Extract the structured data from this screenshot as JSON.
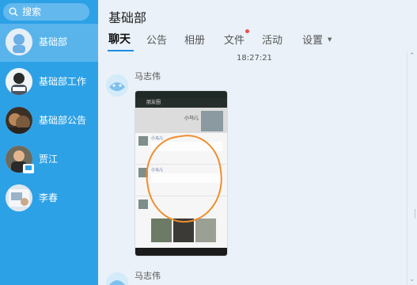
{
  "search": {
    "placeholder": "搜索"
  },
  "sidebar": {
    "items": [
      {
        "label": "基础部",
        "active": true
      },
      {
        "label": "基础部工作"
      },
      {
        "label": "基础部公告"
      },
      {
        "label": "贾江"
      },
      {
        "label": "李春"
      }
    ]
  },
  "header": {
    "title": "基础部",
    "tabs": [
      {
        "label": "聊天",
        "active": true
      },
      {
        "label": "公告"
      },
      {
        "label": "相册"
      },
      {
        "label": "文件",
        "has_dot": true
      },
      {
        "label": "活动"
      },
      {
        "label": "设置"
      }
    ]
  },
  "chat": {
    "timestamp": "18:27:21",
    "messages": [
      {
        "sender": "马志伟",
        "image": {
          "bar_title": "朋友圈",
          "cover_name": "小马儿",
          "post_name": "小马儿"
        }
      },
      {
        "sender": "马志伟"
      }
    ]
  },
  "colors": {
    "sidebar": "#2da1e6",
    "accent": "#1a8fe0",
    "dot": "#ef4f4f",
    "annotation": "#ef8e2e"
  }
}
